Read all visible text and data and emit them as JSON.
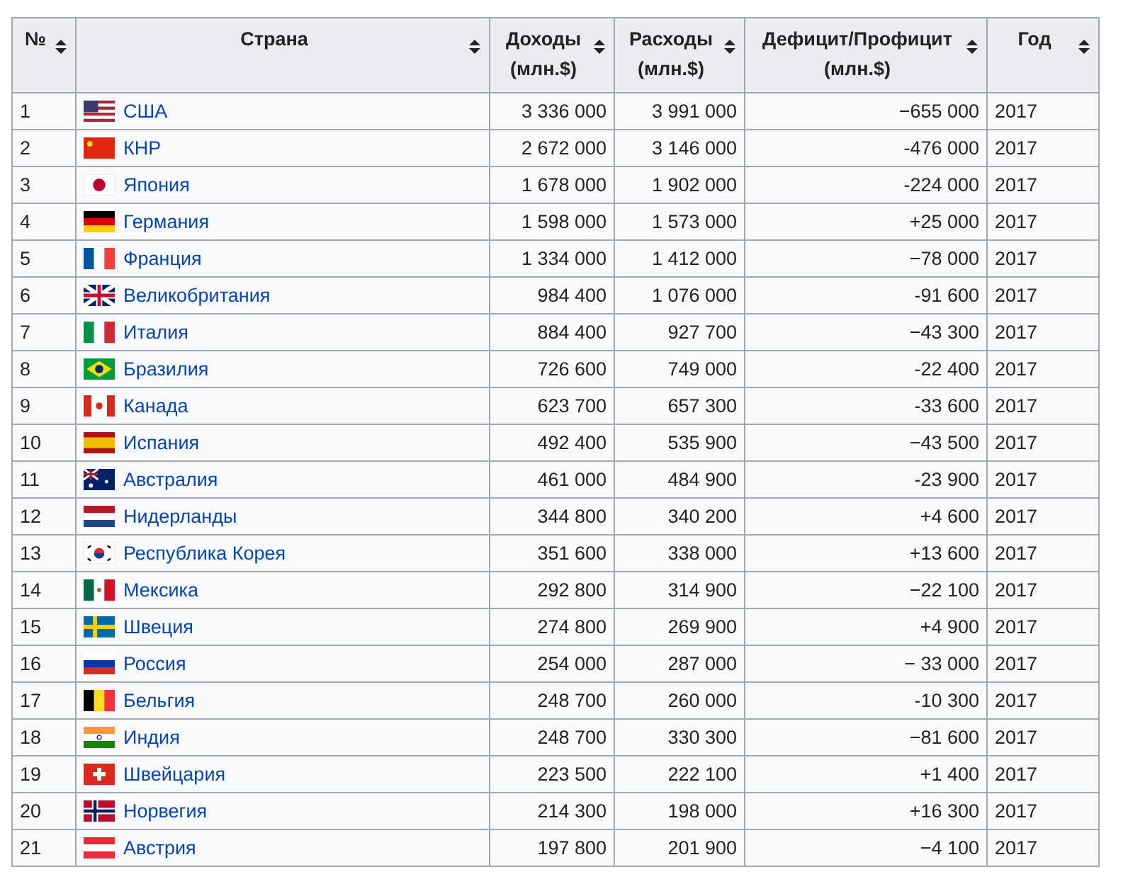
{
  "table": {
    "columns": [
      "№",
      "Страна",
      "Доходы (млн.$)",
      "Расходы (млн.$)",
      "Дефицит/Профицит (млн.$)",
      "Год"
    ],
    "rows": [
      {
        "rank": "1",
        "country": "США",
        "revenue": "3 336 000",
        "expenses": "3 991 000",
        "balance": "−655 000",
        "year": "2017"
      },
      {
        "rank": "2",
        "country": "КНР",
        "revenue": "2 672 000",
        "expenses": "3 146 000",
        "balance": "-476 000",
        "year": "2017"
      },
      {
        "rank": "3",
        "country": "Япония",
        "revenue": "1 678 000",
        "expenses": "1 902 000",
        "balance": "-224 000",
        "year": "2017"
      },
      {
        "rank": "4",
        "country": "Германия",
        "revenue": "1 598 000",
        "expenses": "1 573 000",
        "balance": "+25 000",
        "year": "2017"
      },
      {
        "rank": "5",
        "country": "Франция",
        "revenue": "1 334 000",
        "expenses": "1 412 000",
        "balance": "−78 000",
        "year": "2017"
      },
      {
        "rank": "6",
        "country": "Великобритания",
        "revenue": "984 400",
        "expenses": "1 076 000",
        "balance": "-91 600",
        "year": "2017"
      },
      {
        "rank": "7",
        "country": "Италия",
        "revenue": "884 400",
        "expenses": "927 700",
        "balance": "−43 300",
        "year": "2017"
      },
      {
        "rank": "8",
        "country": "Бразилия",
        "revenue": "726 600",
        "expenses": "749 000",
        "balance": "-22 400",
        "year": "2017"
      },
      {
        "rank": "9",
        "country": "Канада",
        "revenue": "623 700",
        "expenses": "657 300",
        "balance": "-33 600",
        "year": "2017"
      },
      {
        "rank": "10",
        "country": "Испания",
        "revenue": "492 400",
        "expenses": "535 900",
        "balance": "−43 500",
        "year": "2017"
      },
      {
        "rank": "11",
        "country": "Австралия",
        "revenue": "461 000",
        "expenses": "484 900",
        "balance": "-23 900",
        "year": "2017"
      },
      {
        "rank": "12",
        "country": "Нидерланды",
        "revenue": "344 800",
        "expenses": "340 200",
        "balance": "+4 600",
        "year": "2017"
      },
      {
        "rank": "13",
        "country": "Республика Корея",
        "revenue": "351 600",
        "expenses": "338 000",
        "balance": "+13 600",
        "year": "2017"
      },
      {
        "rank": "14",
        "country": "Мексика",
        "revenue": "292 800",
        "expenses": "314 900",
        "balance": "−22 100",
        "year": "2017"
      },
      {
        "rank": "15",
        "country": "Швеция",
        "revenue": "274 800",
        "expenses": "269 900",
        "balance": "+4 900",
        "year": "2017"
      },
      {
        "rank": "16",
        "country": "Россия",
        "revenue": "254 000",
        "expenses": "287 000",
        "balance": "− 33 000",
        "year": "2017"
      },
      {
        "rank": "17",
        "country": "Бельгия",
        "revenue": "248 700",
        "expenses": "260 000",
        "balance": "-10 300",
        "year": "2017"
      },
      {
        "rank": "18",
        "country": "Индия",
        "revenue": "248 700",
        "expenses": "330 300",
        "balance": "−81 600",
        "year": "2017"
      },
      {
        "rank": "19",
        "country": "Швейцария",
        "revenue": "223 500",
        "expenses": "222 100",
        "balance": "+1 400",
        "year": "2017"
      },
      {
        "rank": "20",
        "country": "Норвегия",
        "revenue": "214 300",
        "expenses": "198 000",
        "balance": "+16 300",
        "year": "2017"
      },
      {
        "rank": "21",
        "country": "Австрия",
        "revenue": "197 800",
        "expenses": "201 900",
        "balance": "−4 100",
        "year": "2017"
      }
    ]
  }
}
